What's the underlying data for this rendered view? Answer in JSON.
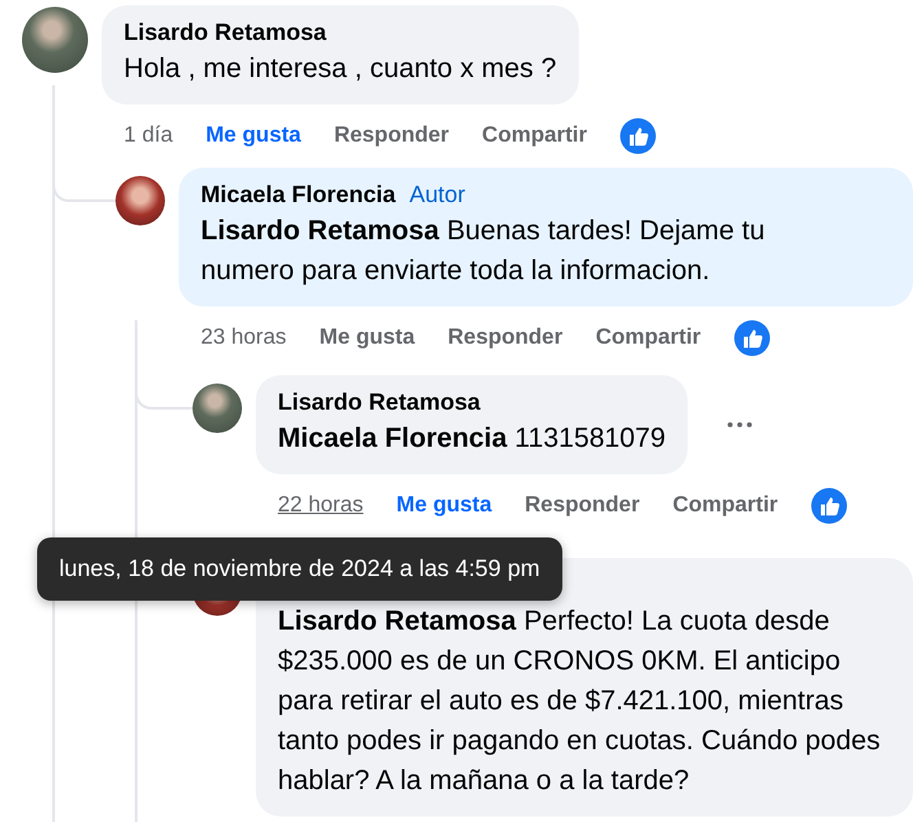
{
  "comments": [
    {
      "author": "Lisardo Retamosa",
      "text": "Hola , me interesa , cuanto x mes ?",
      "actions": {
        "time": "1 día",
        "time_hovered": false,
        "like": "Me gusta",
        "liked": true,
        "reply": "Responder",
        "share": "Compartir",
        "reacted": true
      },
      "children": [
        {
          "author": "Micaela Florencia",
          "badge": "Autor",
          "mention": "Lisardo Retamosa",
          "text": "Buenas tardes! Dejame tu numero para enviarte toda la informacion.",
          "actions": {
            "time": "23 horas",
            "time_hovered": false,
            "like": "Me gusta",
            "liked": false,
            "reply": "Responder",
            "share": "Compartir",
            "reacted": true
          },
          "children": [
            {
              "author": "Lisardo Retamosa",
              "mention": "Micaela Florencia",
              "text": "1131581079",
              "more": true,
              "actions": {
                "time": "22 horas",
                "time_hovered": true,
                "like": "Me gusta",
                "liked": true,
                "reply": "Responder",
                "share": "Compartir",
                "reacted": true
              }
            },
            {
              "mention": "Lisardo Retamosa",
              "text": "Perfecto! La cuota desde $235.000 es de un CRONOS 0KM. El anticipo para retirar el auto es de $7.421.100, mientras tanto podes ir pagando en cuotas. Cuándo podes hablar? A la mañana o a la tarde?"
            }
          ]
        }
      ]
    }
  ],
  "tooltip": {
    "text": "lunes, 18 de noviembre de 2024 a las 4:59 pm"
  }
}
